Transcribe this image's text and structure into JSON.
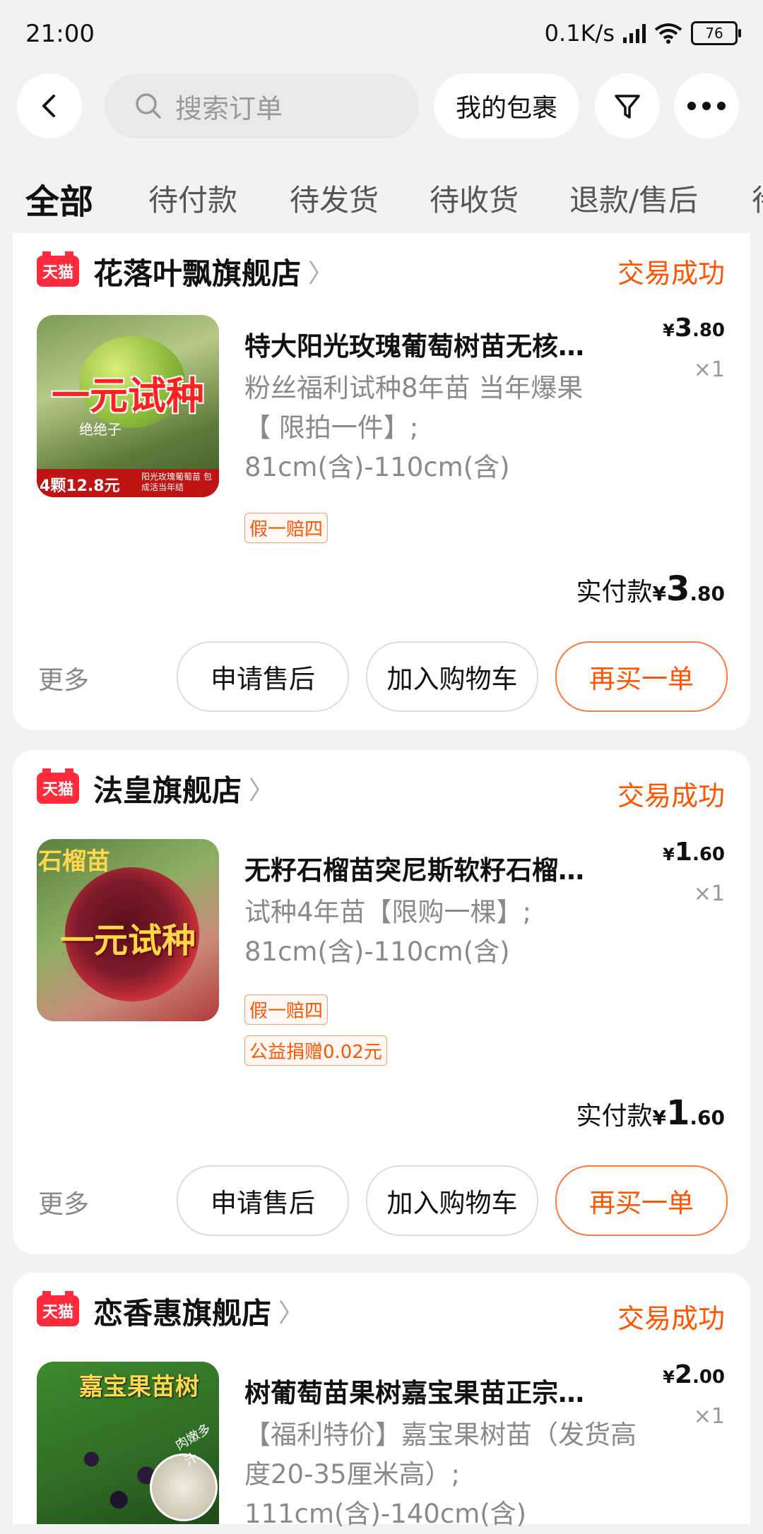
{
  "status_bar": {
    "time": "21:00",
    "speed": "0.1K/s",
    "battery": "76"
  },
  "header": {
    "search_placeholder": "搜索订单",
    "packages": "我的包裹"
  },
  "tabs": [
    "全部",
    "待付款",
    "待发货",
    "待收货",
    "退款/售后",
    "待"
  ],
  "orders": [
    {
      "shop": "花落叶飘旗舰店",
      "status": "交易成功",
      "title": "特大阳光玫瑰葡萄树苗无核巨峰葡萄苗",
      "sku_lines": [
        "粉丝福利试种8年苗  当年爆果",
        "【 限拍一件】;",
        "81cm(含)-110cm(含)"
      ],
      "tags": [
        "假一赔四"
      ],
      "price_symbol": "¥",
      "price_int": "3",
      "price_dec": ".80",
      "qty": "×1",
      "paid_label": "实付款",
      "more": "更多",
      "buttons": [
        "申请售后",
        "加入购物车",
        "再买一单"
      ],
      "thumb_main": "一元试种",
      "thumb_sub": "绝绝子",
      "thumb_bottom": "4颗12.8元",
      "thumb_badge": "阳光玫瑰葡萄苗 包成活当年结"
    },
    {
      "shop": "法皇旗舰店",
      "status": "交易成功",
      "title": "无籽石榴苗突尼斯软籽石榴树苗果树苗",
      "sku_lines": [
        "试种4年苗【限购一棵】;",
        "81cm(含)-110cm(含)"
      ],
      "tags": [
        "假一赔四",
        "公益捐赠0.02元"
      ],
      "price_symbol": "¥",
      "price_int": "1",
      "price_dec": ".60",
      "qty": "×1",
      "paid_label": "实付款",
      "more": "更多",
      "buttons": [
        "申请售后",
        "加入购物车",
        "再买一单"
      ],
      "thumb_main": "一元试种",
      "thumb_top": "石榴苗"
    },
    {
      "shop": "恋香惠旗舰店",
      "status": "交易成功",
      "title": "树葡萄苗果树嘉宝果苗正宗沙巴四季",
      "sku_lines": [
        "【福利特价】嘉宝果树苗（发货高",
        "度20-35厘米高）;",
        "111cm(含)-140cm(含)"
      ],
      "price_symbol": "¥",
      "price_int": "2",
      "price_dec": ".00",
      "qty": "×1",
      "thumb_top": "嘉宝果苗树",
      "thumb_side": "肉嫩多汁"
    }
  ]
}
